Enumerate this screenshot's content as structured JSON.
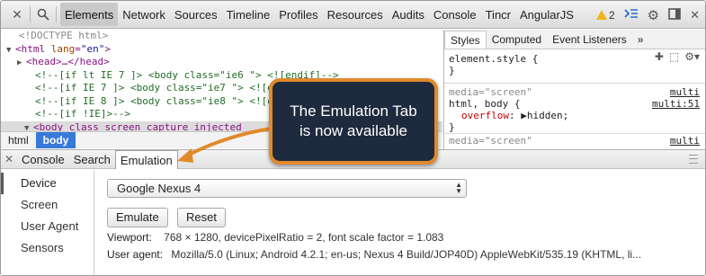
{
  "toolbar": {
    "tabs": [
      "Elements",
      "Network",
      "Sources",
      "Timeline",
      "Profiles",
      "Resources",
      "Audits",
      "Console",
      "Tincr",
      "AngularJS"
    ],
    "active_tab": "Elements",
    "warning_count": "2",
    "icons": [
      "search-icon",
      "console-drawer-icon",
      "settings-icon",
      "dock-icon",
      "close-icon"
    ]
  },
  "elements": {
    "lines": [
      {
        "indent": 1,
        "text": "<!DOCTYPE html>",
        "kind": "doctype"
      },
      {
        "indent": 0,
        "triangle": "▼",
        "tag_open": "<html ",
        "attr": "lang",
        "val": "\"en\"",
        "tag_close": ">"
      },
      {
        "indent": 1,
        "triangle": "▶",
        "text": "<head>…</head>",
        "kind": "tag"
      },
      {
        "indent": 2,
        "text": "<!--[if lt IE 7 ]>  <body class=\"ie6 \"> <![endif]-->",
        "kind": "comment"
      },
      {
        "indent": 2,
        "text": "<!--[if IE 7 ]>    <body class=\"ie7 \"> <![endif]-->",
        "kind": "comment"
      },
      {
        "indent": 2,
        "text": "<!--[if IE 8 ]>    <body class=\"ie8 \"> <![endif]-->",
        "kind": "comment"
      },
      {
        "indent": 2,
        "text": "<!--[if !IE]>-->",
        "kind": "comment"
      },
      {
        "indent": 1,
        "triangle": "▼",
        "text": "<body class screen_capture_injected",
        "kind": "selected"
      }
    ]
  },
  "breadcrumb": [
    "html",
    "body"
  ],
  "sidebar": {
    "tabs": [
      "Styles",
      "Computed",
      "Event Listeners"
    ],
    "more": "»",
    "element_style": "element.style {",
    "element_style_close": "}",
    "rules": [
      {
        "media": "media=\"screen\"",
        "source": "multi",
        "selector": "html, body {",
        "selector_source": "multi:51",
        "property": "overflow",
        "value": "hidden;",
        "close": "}"
      },
      {
        "media": "media=\"screen\"",
        "source": "multi"
      }
    ]
  },
  "drawer": {
    "tabs": [
      "Console",
      "Search",
      "Emulation"
    ],
    "active_tab": "Emulation"
  },
  "emulation": {
    "nav": [
      "Device",
      "Screen",
      "User Agent",
      "Sensors"
    ],
    "active_nav": "Device",
    "device_select": "Google Nexus 4",
    "emulate_label": "Emulate",
    "reset_label": "Reset",
    "viewport_label": "Viewport:",
    "viewport_value": "768 × 1280, devicePixelRatio = 2, font scale factor = 1.083",
    "useragent_label": "User agent:",
    "useragent_value": "Mozilla/5.0 (Linux; Android 4.2.1; en-us; Nexus 4 Build/JOP40D) AppleWebKit/535.19 (KHTML, li..."
  },
  "callout": {
    "line1": "The Emulation Tab",
    "line2": "is now available",
    "border_color": "#e08a2c",
    "fill_color": "#1e2a3d"
  }
}
